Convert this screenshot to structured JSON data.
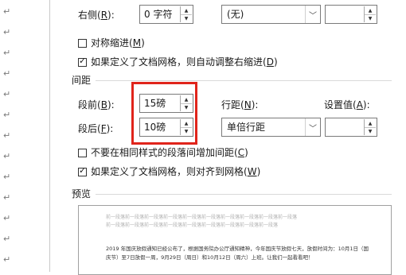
{
  "indent": {
    "right_label": "右侧",
    "right_hotkey": "R",
    "right_value": "0 字符",
    "special_value": "(无)",
    "by_value": "",
    "mirror_label": "对称缩进",
    "mirror_hotkey": "M",
    "auto_adjust_label": "如果定义了文档网格，则自动调整右缩进",
    "auto_adjust_hotkey": "D"
  },
  "spacing": {
    "section_title": "间距",
    "before_label": "段前",
    "before_hotkey": "B",
    "before_value": "15磅",
    "after_label": "段后",
    "after_hotkey": "F",
    "after_value": "10磅",
    "line_spacing_label": "行距",
    "line_spacing_hotkey": "N",
    "line_spacing_value": "单倍行距",
    "at_label": "设置值",
    "at_hotkey": "A",
    "at_value": "",
    "no_space_label": "不要在相同样式的段落间增加间距",
    "no_space_hotkey": "C",
    "snap_grid_label": "如果定义了文档网格，则对齐到网格",
    "snap_grid_hotkey": "W"
  },
  "preview": {
    "section_title": "预览",
    "prev_para_line": "前一段落前一段落前一段落前一段落前一段落前一段落前一段落前一段落前一段落前一段落",
    "prev_para_line2": "前一段落前一段落前一段落前一段落前一段落前一段落前一段落前一段落前一段落",
    "body_text": "2019 年国庆放假通知已经公布了，根据国务院办公厅通知精神，今年国庆节放假七天，放假时间为：10月1日（国庆节）至7日放假一周，9月29日（周日）和10月12日（周六）上班。让我们一起看看吧！"
  },
  "state": {
    "mirror_checked": false,
    "auto_adjust_checked": true,
    "no_space_checked": false,
    "snap_grid_checked": true
  },
  "colors": {
    "highlight": "#e0241b"
  }
}
